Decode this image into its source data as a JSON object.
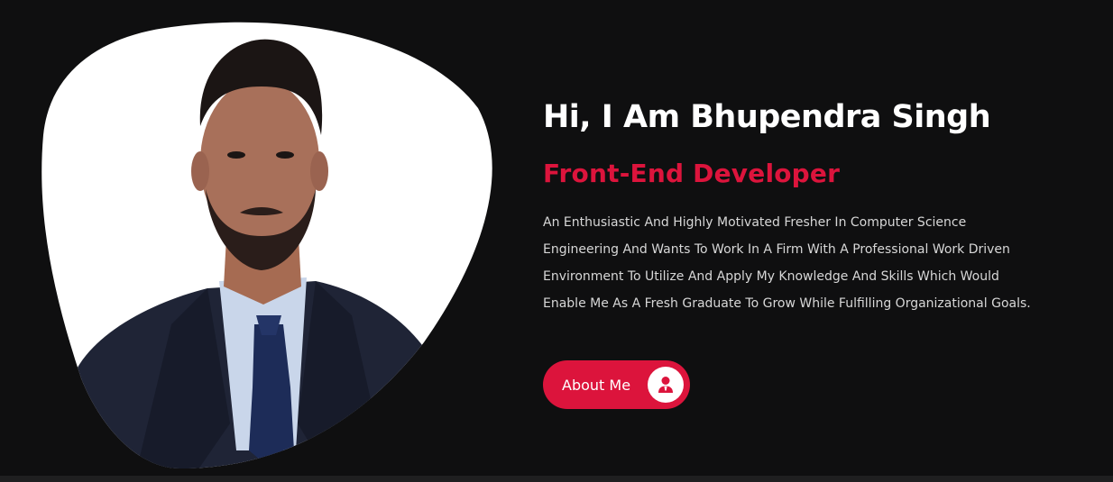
{
  "hero": {
    "greeting": "Hi, I Am Bhupendra Singh",
    "role": "Front-End Developer",
    "bio": "An Enthusiastic And Highly Motivated Fresher In Computer Science Engineering And Wants To Work In A Firm With A Professional Work Driven Environment To Utilize And Apply My Knowledge And Skills Which Would Enable Me As A Fresh Graduate To Grow While Fulfilling Organizational Goals.",
    "about_button": {
      "label": "About Me",
      "icon": "user-icon"
    },
    "photo": {
      "subject": "profile-photo"
    }
  },
  "colors": {
    "background": "#0f0f10",
    "accent": "#dc143c",
    "heading": "#ffffff",
    "body_text": "#d7d7d7"
  }
}
